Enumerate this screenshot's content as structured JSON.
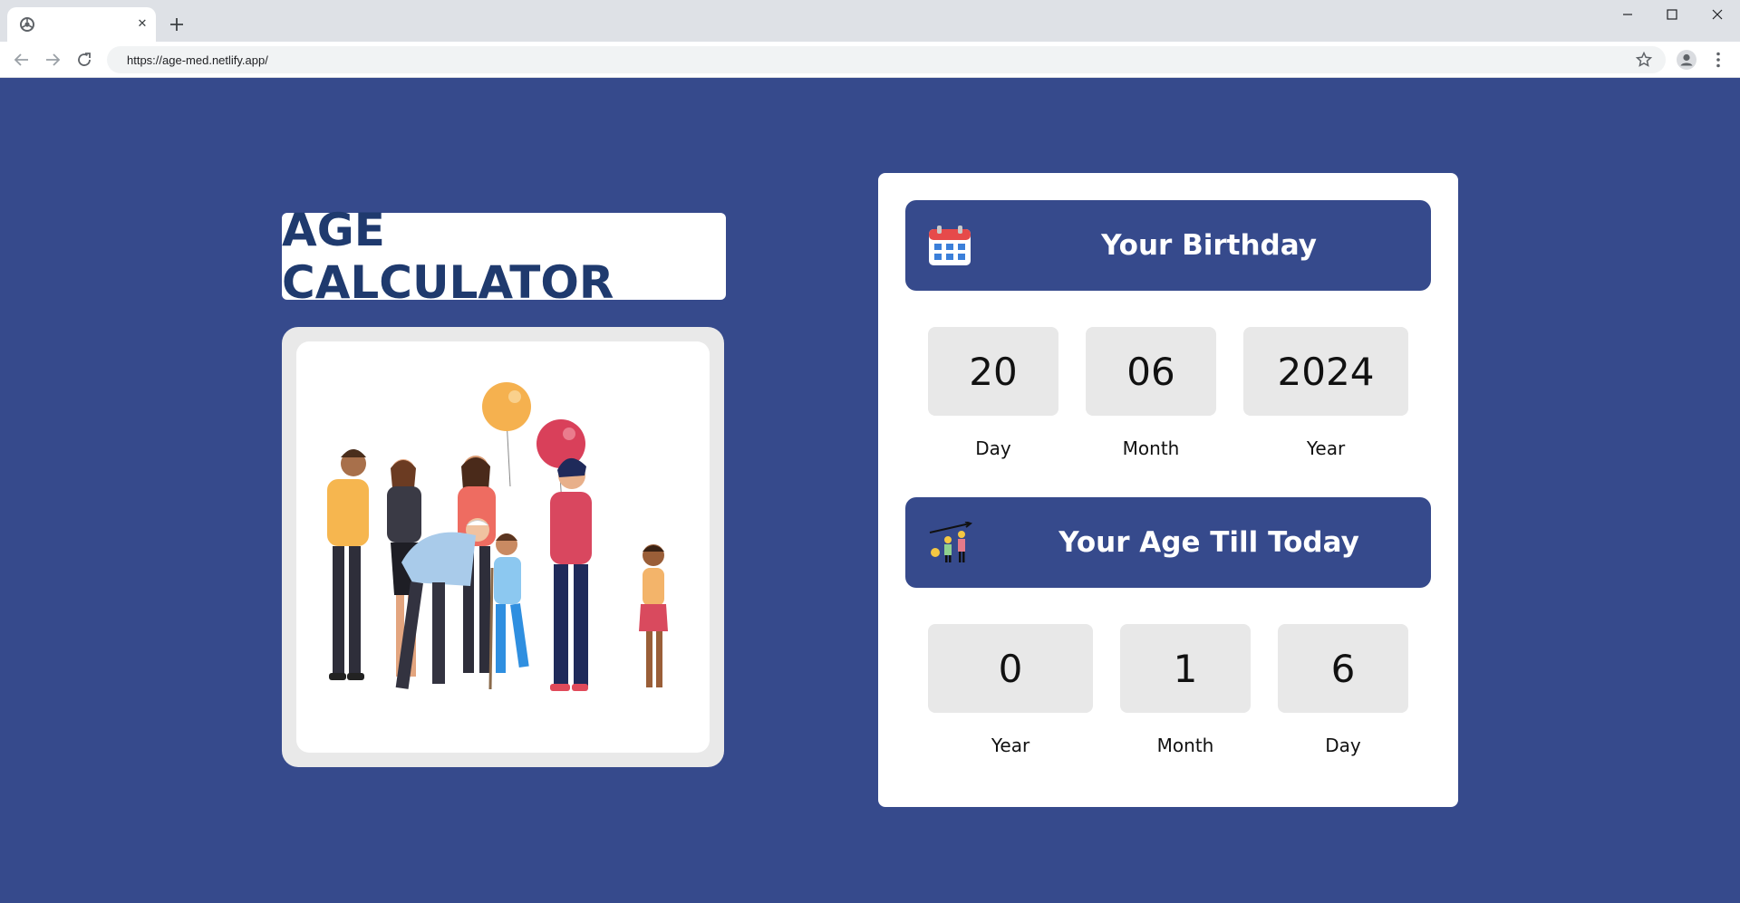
{
  "browser": {
    "tab_title": "",
    "url": "https://age-med.netlify.app/"
  },
  "page": {
    "title": "AGE CALCULATOR",
    "illustration": "family-group-with-balloons-illustration"
  },
  "birthday": {
    "header": "Your Birthday",
    "icon": "calendar-icon",
    "fields": [
      {
        "value": "20",
        "label": "Day"
      },
      {
        "value": "06",
        "label": "Month"
      },
      {
        "value": "2024",
        "label": "Year"
      }
    ]
  },
  "age": {
    "header": "Your Age Till Today",
    "icon": "family-height-icon",
    "fields": [
      {
        "value": "0",
        "label": "Year"
      },
      {
        "value": "1",
        "label": "Month"
      },
      {
        "value": "6",
        "label": "Day"
      }
    ]
  },
  "colors": {
    "background": "#364a8c",
    "title": "#1f3a6e",
    "box": "#e8e8e8"
  }
}
